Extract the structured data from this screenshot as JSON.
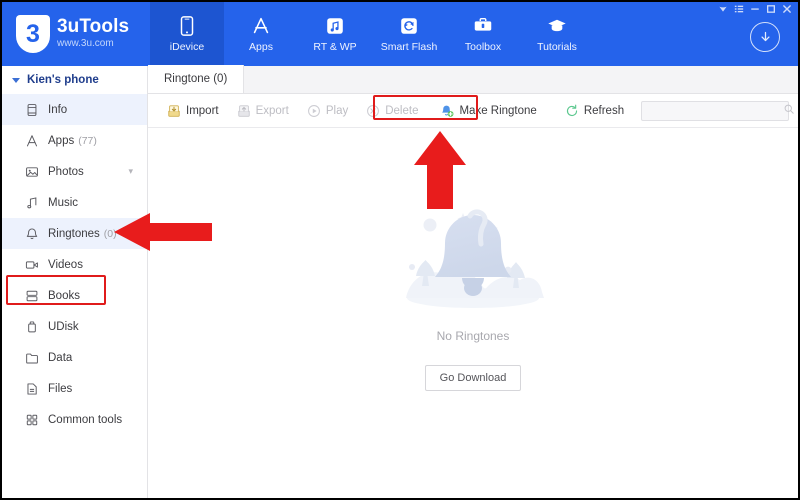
{
  "window": {
    "controls": [
      {
        "name": "skin-icon",
        "glyph": "skin"
      },
      {
        "name": "menu-icon",
        "glyph": "menu"
      },
      {
        "name": "minimize-icon",
        "glyph": "minimize"
      },
      {
        "name": "maximize-icon",
        "glyph": "maximize"
      },
      {
        "name": "close-icon",
        "glyph": "close"
      }
    ],
    "download_icon": "download-circle-icon"
  },
  "header": {
    "brand_mark": "3",
    "brand_name": "3uTools",
    "brand_url": "www.3u.com",
    "accent_color": "#2563eb",
    "active_color": "#1d55d1",
    "tabs": [
      {
        "label": "iDevice",
        "icon": "phone-icon",
        "active": true
      },
      {
        "label": "Apps",
        "icon": "appstore-icon",
        "active": false
      },
      {
        "label": "RT & WP",
        "icon": "ringtone-wallpaper-icon",
        "active": false
      },
      {
        "label": "Smart Flash",
        "icon": "refresh-flash-icon",
        "active": false
      },
      {
        "label": "Toolbox",
        "icon": "toolbox-icon",
        "active": false
      },
      {
        "label": "Tutorials",
        "icon": "graduation-cap-icon",
        "active": false
      }
    ]
  },
  "sidebar": {
    "device_name": "Kien's phone",
    "items": [
      {
        "label": "Info",
        "icon": "info-device-icon",
        "count": "",
        "selected": true,
        "chevron": false
      },
      {
        "label": "Apps",
        "icon": "appstore-icon",
        "count": "(77)",
        "selected": false,
        "chevron": false
      },
      {
        "label": "Photos",
        "icon": "photo-icon",
        "count": "",
        "selected": false,
        "chevron": true
      },
      {
        "label": "Music",
        "icon": "music-note-icon",
        "count": "",
        "selected": false,
        "chevron": false
      },
      {
        "label": "Ringtones",
        "icon": "bell-icon",
        "count": "(0)",
        "selected": true,
        "chevron": false,
        "highlighted": true
      },
      {
        "label": "Videos",
        "icon": "video-camera-icon",
        "count": "",
        "selected": false,
        "chevron": false
      },
      {
        "label": "Books",
        "icon": "books-icon",
        "count": "",
        "selected": false,
        "chevron": false
      },
      {
        "label": "UDisk",
        "icon": "usb-disk-icon",
        "count": "",
        "selected": false,
        "chevron": false
      },
      {
        "label": "Data",
        "icon": "folder-icon",
        "count": "",
        "selected": false,
        "chevron": false
      },
      {
        "label": "Files",
        "icon": "file-icon",
        "count": "",
        "selected": false,
        "chevron": false
      },
      {
        "label": "Common tools",
        "icon": "grid-tools-icon",
        "count": "",
        "selected": false,
        "chevron": false
      }
    ]
  },
  "content": {
    "tab_label": "Ringtone (0)",
    "toolbar": [
      {
        "label": "Import",
        "icon": "import-tray-icon",
        "disabled": false,
        "highlighted": false
      },
      {
        "label": "Export",
        "icon": "export-tray-icon",
        "disabled": true,
        "highlighted": false
      },
      {
        "label": "Play",
        "icon": "play-circle-icon",
        "disabled": true,
        "highlighted": false
      },
      {
        "label": "Delete",
        "icon": "delete-circle-icon",
        "disabled": true,
        "highlighted": false
      },
      {
        "label": "Make Ringtone",
        "icon": "make-ringtone-icon",
        "disabled": false,
        "highlighted": true
      },
      {
        "label": "Refresh",
        "icon": "refresh-icon",
        "disabled": false,
        "highlighted": false
      }
    ],
    "search": {
      "value": "",
      "placeholder": "",
      "icon": "search-icon"
    },
    "empty_state": {
      "illustration": "bell-empty-illustration",
      "message": "No Ringtones",
      "button_label": "Go Download"
    }
  },
  "annotations": {
    "color": "#e81c1c",
    "up_arrow": "points-to-make-ringtone-button",
    "left_arrow": "points-to-ringtones-sidebar-item"
  }
}
